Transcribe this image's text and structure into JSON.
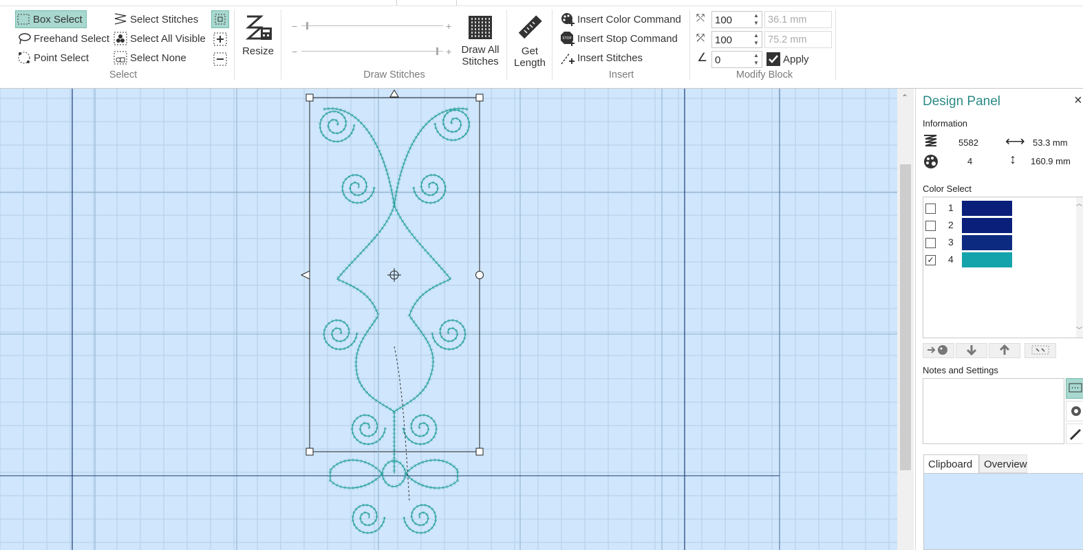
{
  "ribbon": {
    "select": {
      "box_select": "Box Select",
      "freehand_select": "Freehand Select",
      "point_select": "Point Select",
      "select_stitches": "Select Stitches",
      "select_all_visible": "Select All Visible",
      "select_none": "Select None",
      "group_label": "Select"
    },
    "resize_label": "Resize",
    "draw": {
      "draw_all": "Draw All",
      "draw_all_2": "Stitches",
      "group_label": "Draw Stitches"
    },
    "get_length": "Get",
    "get_length_2": "Length",
    "insert": {
      "color_command": "Insert Color Command",
      "stop_command": "Insert Stop Command",
      "stitches": "Insert Stitches",
      "group_label": "Insert"
    },
    "modify": {
      "width_pct": "100",
      "height_pct": "100",
      "angle": "0",
      "width_mm": "36.1 mm",
      "height_mm": "75.2 mm",
      "apply": "Apply",
      "group_label": "Modify Block"
    }
  },
  "panel": {
    "title": "Design Panel",
    "close": "×",
    "information": "Information",
    "stitch_count": "5582",
    "width": "53.3 mm",
    "color_count": "4",
    "height": "160.9 mm",
    "color_select": "Color Select",
    "colors": [
      {
        "num": "1",
        "checked": false,
        "color": "#0a1f7a"
      },
      {
        "num": "2",
        "checked": false,
        "color": "#0a1f7a"
      },
      {
        "num": "3",
        "checked": false,
        "color": "#0b2a80"
      },
      {
        "num": "4",
        "checked": true,
        "color": "#14a3aa"
      }
    ],
    "notes_label": "Notes and Settings",
    "tabs": [
      "Clipboard",
      "Overview"
    ]
  },
  "colors": {
    "accent": "#2a8a85",
    "stitch": "#1a9a95",
    "canvas_bg": "#cfe6fc",
    "hoop_line": "#1b3a70"
  }
}
